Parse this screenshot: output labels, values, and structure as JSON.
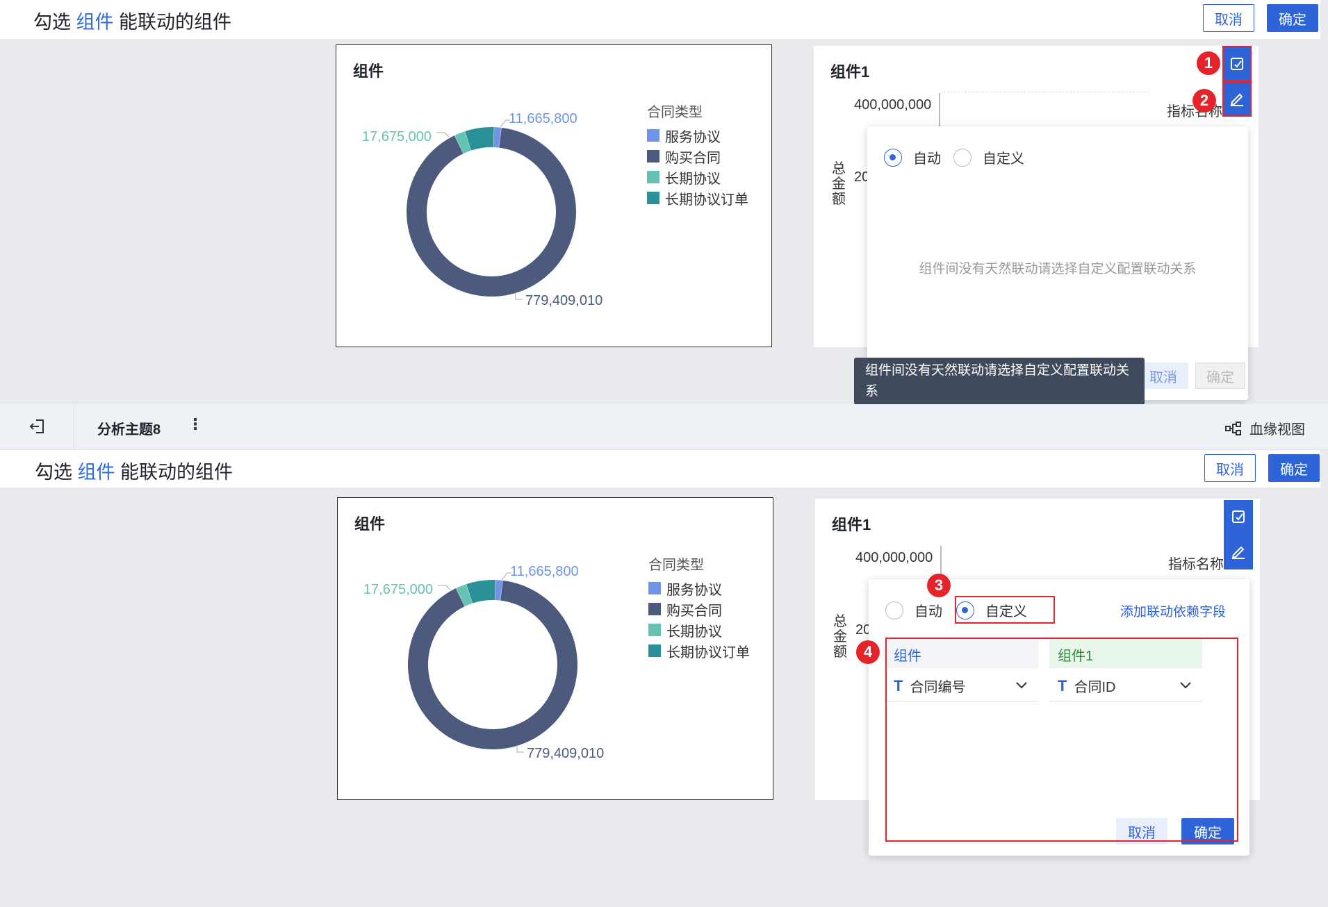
{
  "banner": {
    "title_prefix": "勾选",
    "title_highlight": "组件",
    "title_suffix": "能联动的组件",
    "cancel_label": "取消",
    "confirm_label": "确定"
  },
  "left_card": {
    "title": "组件",
    "chart_data": {
      "type": "pie",
      "donut": true,
      "legend_title": "合同类型",
      "categories": [
        "服务协议",
        "购买合同",
        "长期协议",
        "长期协议订单"
      ],
      "values": [
        11665800,
        779409010,
        17675000,
        48000000
      ],
      "colors": [
        "#6f94e8",
        "#4b5a7d",
        "#66c2b2",
        "#2a9199"
      ],
      "data_labels": [
        "11,665,800",
        "779,409,010",
        "17,675,000",
        ""
      ],
      "legend_position": "right"
    }
  },
  "right_card": {
    "title": "组件1",
    "y_tick_top": "400,000,000",
    "y_tick_partial": "20",
    "y_axis_label": "总金额",
    "legend_partial": "指标名称"
  },
  "top_popup": {
    "radio_auto": "自动",
    "radio_custom": "自定义",
    "empty_message": "组件间没有天然联动请选择自定义配置联动关系",
    "cancel_label": "取消",
    "confirm_label": "确定",
    "tooltip": "组件间没有天然联动请选择自定义配置联动关系"
  },
  "nav": {
    "topic_title": "分析主题8",
    "lineage_label": "血缘视图"
  },
  "bottom_popup": {
    "radio_auto": "自动",
    "radio_custom": "自定义",
    "add_field_link": "添加联动依赖字段",
    "col_left_header": "组件",
    "col_right_header": "组件1",
    "left_field": "合同编号",
    "right_field": "合同ID",
    "cancel_label": "取消",
    "confirm_label": "确定"
  },
  "badges": [
    "1",
    "2",
    "3",
    "4"
  ],
  "colors": {
    "primary": "#2f63d8",
    "highlight": "#e5232b"
  }
}
